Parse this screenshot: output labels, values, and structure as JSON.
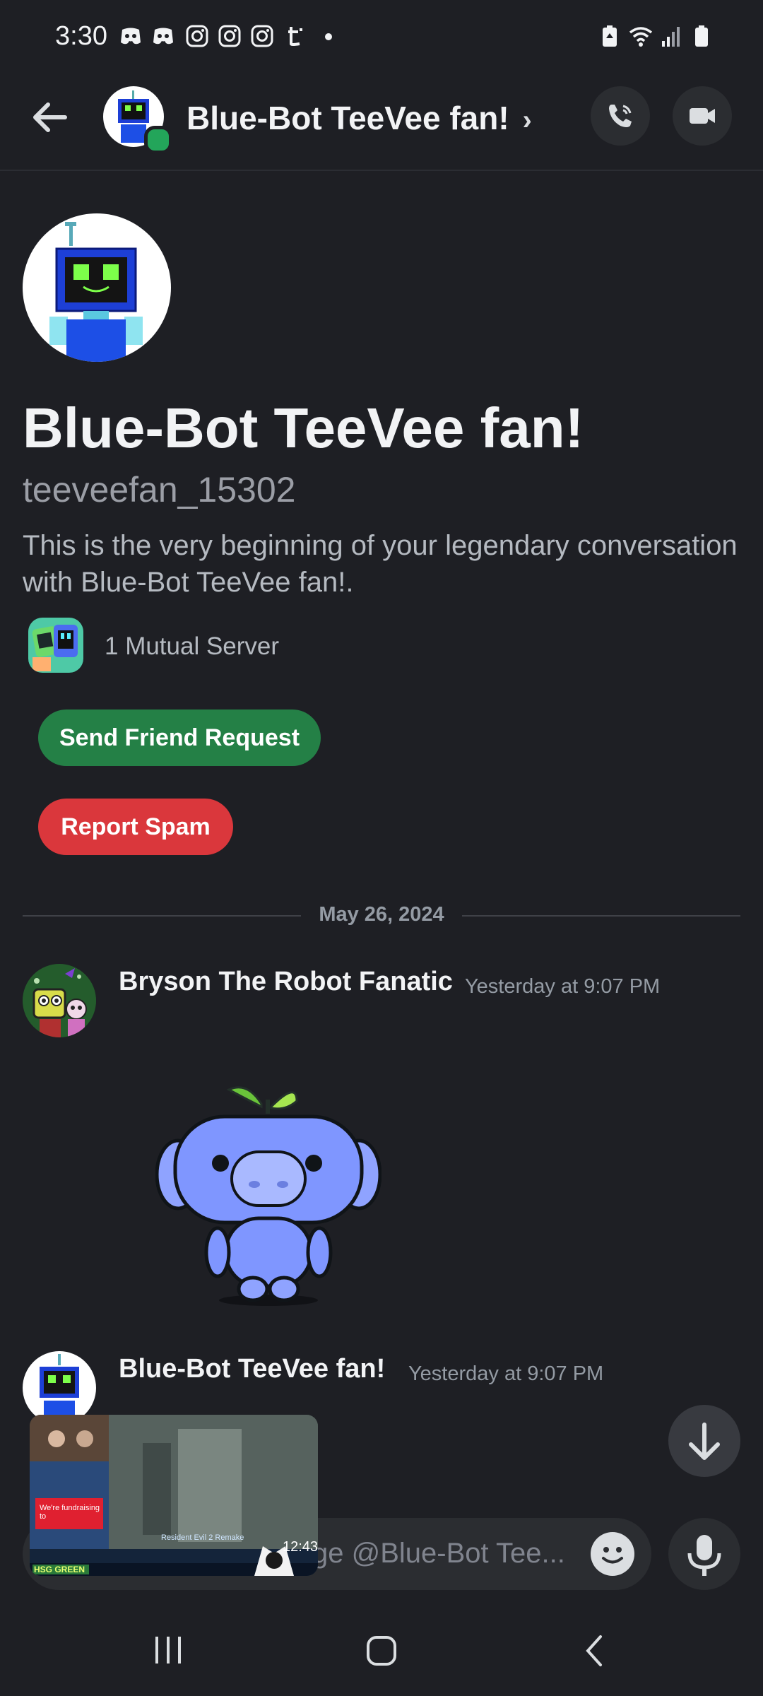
{
  "status_bar": {
    "time": "3:30",
    "left_icons": [
      "discord-icon",
      "discord-icon",
      "instagram-icon",
      "instagram-icon",
      "instagram-icon",
      "threads-icon",
      "dot-icon"
    ],
    "right_icons": [
      "battery-saver-icon",
      "wifi-icon",
      "signal-icon",
      "battery-icon"
    ]
  },
  "header": {
    "title": "Blue-Bot TeeVee fan!",
    "chevron": "›",
    "online": true,
    "icons": [
      "back-arrow-icon",
      "call-icon",
      "video-icon"
    ]
  },
  "profile": {
    "display_name": "Blue-Bot TeeVee fan!",
    "username": "teeveefan_15302",
    "intro": "This is the very beginning of your legendary conversation with Blue-Bot TeeVee fan!.",
    "mutual_servers": "1 Mutual Server",
    "send_friend_request": "Send Friend Request",
    "report_spam": "Report Spam"
  },
  "date_divider": "May 26, 2024",
  "messages": [
    {
      "author": "Bryson The Robot Fanatic",
      "timestamp": "Yesterday at 9:07 PM",
      "content_type": "sticker",
      "sticker": "wumpus-sticker"
    },
    {
      "author": "Blue-Bot TeeVee fan!",
      "timestamp": "Yesterday at 9:07 PM"
    }
  ],
  "composer": {
    "placeholder_visible": "ge @Blue-Bot Tee...",
    "icons": [
      "emoji-icon",
      "mic-icon"
    ]
  },
  "pip": {
    "caption": "Resident Evil 2 Remake",
    "clock": "12:43",
    "banner": "We're fundraising to",
    "ticker": "HSG GREEN"
  },
  "colors": {
    "background": "#1e1f24",
    "green_button": "#248046",
    "red_button": "#da373c",
    "online": "#23a55a"
  }
}
